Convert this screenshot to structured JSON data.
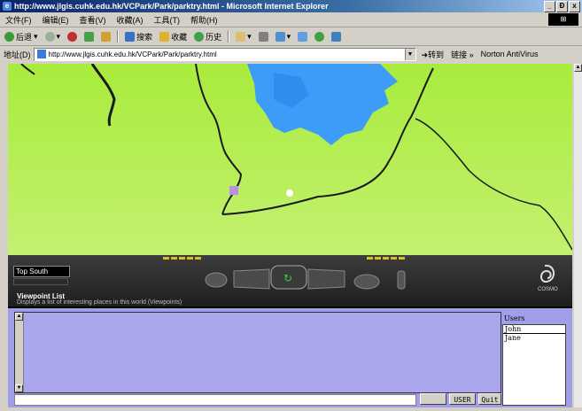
{
  "window": {
    "title": "http://www.jlgis.cuhk.edu.hk/VCPark/Park/parktry.html - Microsoft Internet Explorer",
    "controls": {
      "minimize": "_",
      "maximize": "Ɖ",
      "close": "x"
    }
  },
  "menu": {
    "items": [
      "文件(F)",
      "编辑(E)",
      "查看(V)",
      "收藏(A)",
      "工具(T)",
      "帮助(H)"
    ]
  },
  "toolbar": {
    "back": "后退",
    "search": "搜索",
    "favorites": "收藏",
    "history": "历史"
  },
  "addressbar": {
    "label": "地址(D)",
    "url": "http://www.jlgis.cuhk.edu.hk/VCPark/Park/parktry.html",
    "go": "转到",
    "links": "链接 »",
    "norton": "Norton AntiVirus"
  },
  "viewer": {
    "viewpoint_name": "Top South",
    "viewpoint_list_title": "Viewpoint List",
    "viewpoint_list_desc": "Displays a list of interesting places in this world (Viewpoints)",
    "brand": "COSMO",
    "colors": {
      "terrain": "#b4ee3c",
      "water": "#3c9cf8",
      "path": "#1a1a1a"
    }
  },
  "chat": {
    "input_value": "",
    "buttons": {
      "disabled_label": "",
      "users": "USER",
      "quit": "Quit"
    },
    "users_label": "Users",
    "users": [
      "John",
      "Jane"
    ]
  }
}
